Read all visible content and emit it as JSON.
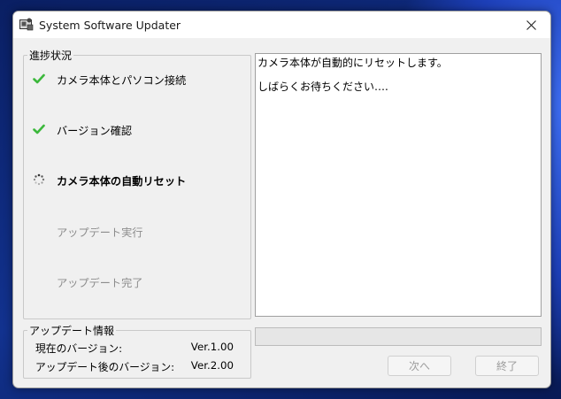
{
  "window": {
    "title": "System Software Updater"
  },
  "progress": {
    "group_label": "進捗状況",
    "steps": [
      {
        "label": "カメラ本体とパソコン接続",
        "state": "done"
      },
      {
        "label": "バージョン確認",
        "state": "done"
      },
      {
        "label": "カメラ本体の自動リセット",
        "state": "in-progress"
      },
      {
        "label": "アップデート実行",
        "state": "pending"
      },
      {
        "label": "アップデート完了",
        "state": "pending"
      }
    ]
  },
  "message": {
    "lines": [
      "カメラ本体が自動的にリセットします。",
      "しばらくお待ちください…."
    ]
  },
  "update_info": {
    "group_label": "アップデート情報",
    "current_label": "現在のバージョン:",
    "current_value": "Ver.1.00",
    "after_label": "アップデート後のバージョン:",
    "after_value": "Ver.2.00"
  },
  "progress_bar": {
    "value_percent": 0
  },
  "buttons": {
    "next_label": "次へ",
    "finish_label": "終了"
  },
  "colors": {
    "check": "#3cb83c",
    "progress_fill": "#06b025",
    "disabled_text": "#8c8c8c"
  }
}
